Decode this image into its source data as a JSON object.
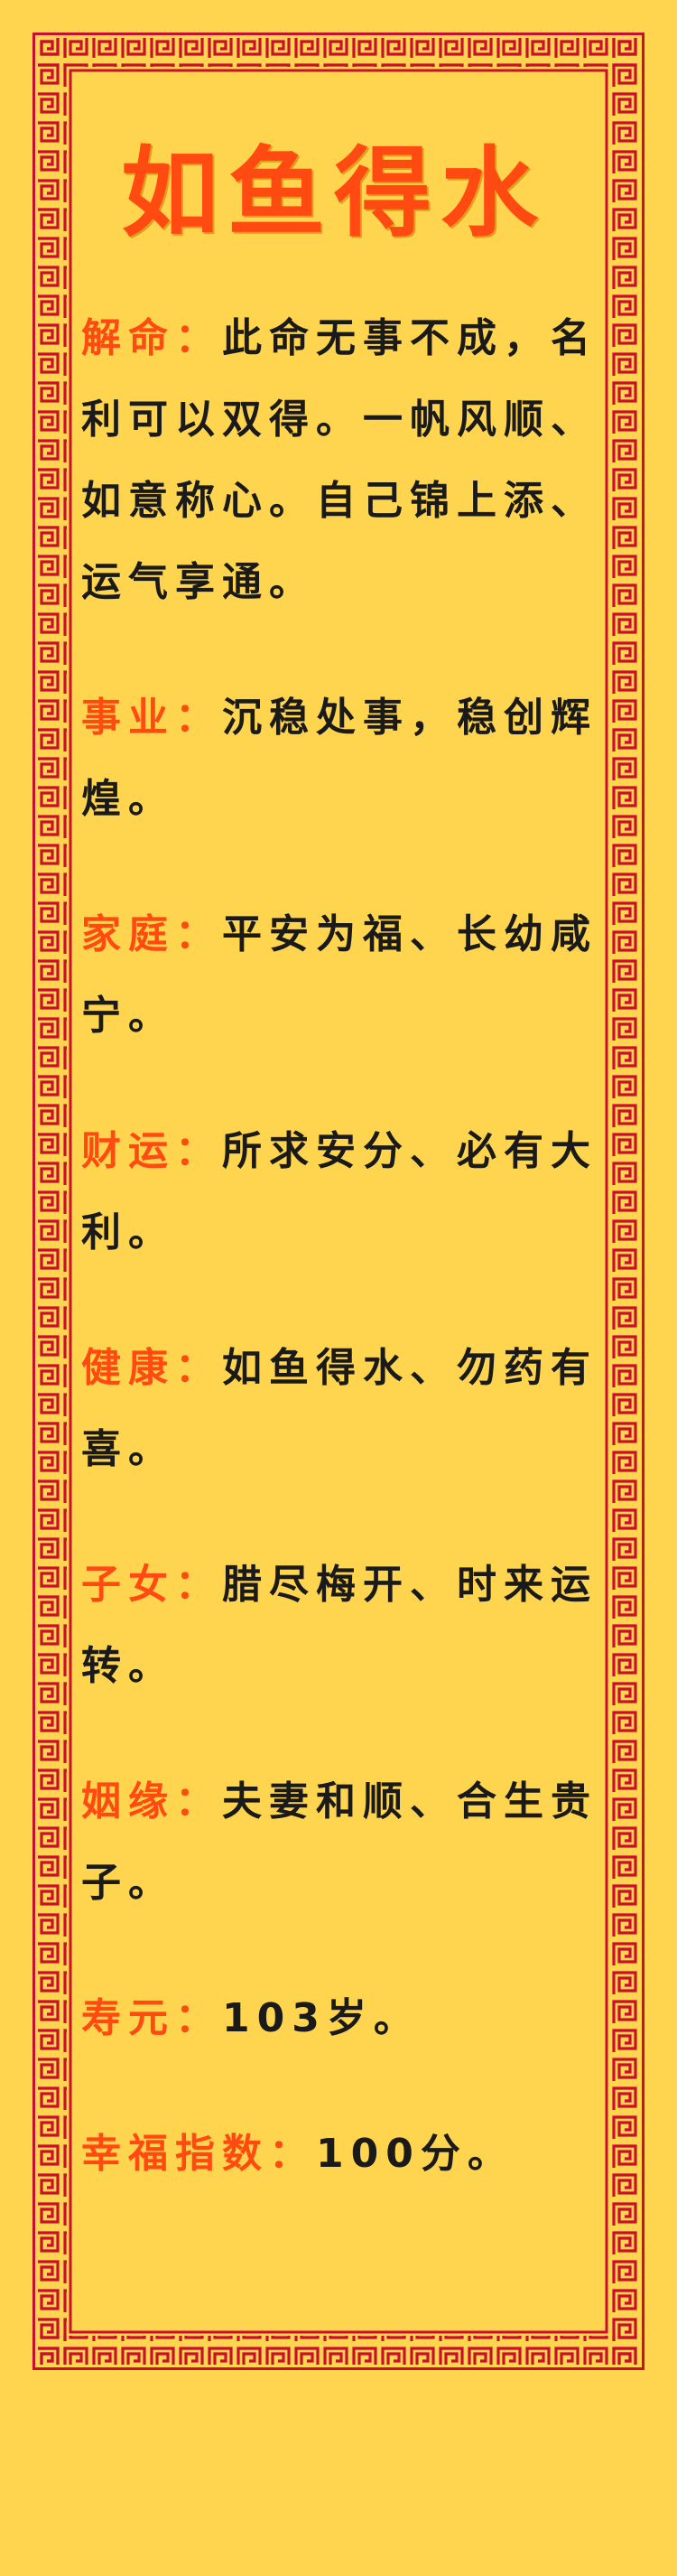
{
  "title": "如鱼得水",
  "sections": [
    {
      "label": "解命：",
      "text": "此命无事不成，名利可以双得。一帆风顺、如意称心。自己锦上添、运气享通。"
    },
    {
      "label": "事业：",
      "text": "沉稳处事，稳创辉煌。"
    },
    {
      "label": "家庭：",
      "text": "平安为福、长幼咸宁。"
    },
    {
      "label": "财运：",
      "text": "所求安分、必有大利。"
    },
    {
      "label": "健康：",
      "text": "如鱼得水、勿药有喜。"
    },
    {
      "label": "子女：",
      "text": "腊尽梅开、时来运转。"
    },
    {
      "label": "姻缘：",
      "text": "夫妻和顺、合生贵子。"
    },
    {
      "label": "寿元：",
      "text": "103岁。"
    },
    {
      "label": "幸福指数：",
      "text": "100分。"
    }
  ],
  "colors": {
    "background": "#FFD54F",
    "border": "#C8102E",
    "label": "#FF4A12",
    "text": "#1a1a1a"
  }
}
